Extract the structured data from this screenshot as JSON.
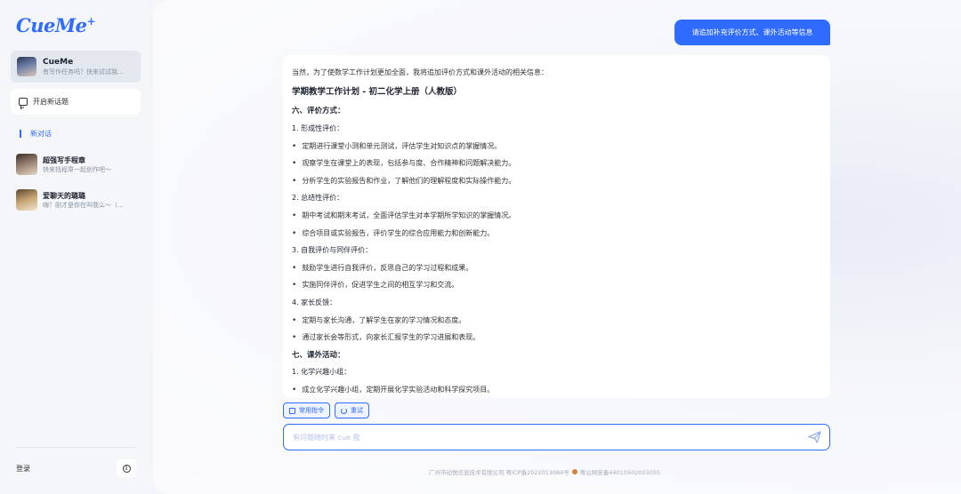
{
  "app": {
    "logo": "CueMe",
    "logo_plus": "+"
  },
  "sidebar": {
    "bot": {
      "name": "CueMe",
      "desc": "有写作任务吗？快来试试我..."
    },
    "new_topic_label": "开启新话题",
    "new_chat_label": "新对话",
    "conversations": [
      {
        "name": "超强写手程章",
        "desc": "快来找程章一起创作吧～"
      },
      {
        "name": "爱聊天的璐璐",
        "desc": "嗨？刚才是你在叫我么～（..."
      }
    ],
    "login_label": "登录",
    "info_icon": "i"
  },
  "chat": {
    "user_message": "请追加补充评价方式、课外活动等信息",
    "answer": [
      {
        "type": "p",
        "text": "当然，为了使数学工作计划更加全面，我将追加评价方式和课外活动的相关信息："
      },
      {
        "type": "h2",
        "text": "学期教学工作计划 - 初二化学上册（人教版）"
      },
      {
        "type": "h3",
        "text": "六、评价方式："
      },
      {
        "type": "num",
        "text": "1. 形成性评价："
      },
      {
        "type": "bullet",
        "text": "定期进行课堂小测和单元测试，评估学生对知识点的掌握情况。"
      },
      {
        "type": "bullet",
        "text": "观察学生在课堂上的表现，包括参与度、合作精神和问题解决能力。"
      },
      {
        "type": "bullet",
        "text": "分析学生的实验报告和作业，了解他们的理解程度和实际操作能力。"
      },
      {
        "type": "num",
        "text": "2. 总结性评价："
      },
      {
        "type": "bullet",
        "text": "期中考试和期末考试，全面评估学生对本学期所学知识的掌握情况。"
      },
      {
        "type": "bullet",
        "text": "综合项目或实验报告，评价学生的综合应用能力和创新能力。"
      },
      {
        "type": "num",
        "text": "3. 自我评价与同伴评价："
      },
      {
        "type": "bullet",
        "text": "鼓励学生进行自我评价，反思自己的学习过程和成果。"
      },
      {
        "type": "bullet",
        "text": "实施同伴评价，促进学生之间的相互学习和交流。"
      },
      {
        "type": "num",
        "text": "4. 家长反馈："
      },
      {
        "type": "bullet",
        "text": "定期与家长沟通，了解学生在家的学习情况和态度。"
      },
      {
        "type": "bullet",
        "text": "通过家长会等形式，向家长汇报学生的学习进展和表现。"
      },
      {
        "type": "h3",
        "text": "七、课外活动："
      },
      {
        "type": "num",
        "text": "1. 化学兴趣小组："
      },
      {
        "type": "bullet",
        "text": "成立化学兴趣小组，定期开展化学实验活动和科学探究项目。"
      }
    ],
    "chips": {
      "commands": "常用指令",
      "retry": "重试"
    },
    "input_placeholder": "有问题随时来 cue 我",
    "footer_company": "广州市动悦信息技术有限公司 粤ICP备2022013084号",
    "footer_police": "粤公网安备44010502003055"
  },
  "colors": {
    "accent": "#2f6bff",
    "sidebar_bg": "#f4f6f9"
  }
}
